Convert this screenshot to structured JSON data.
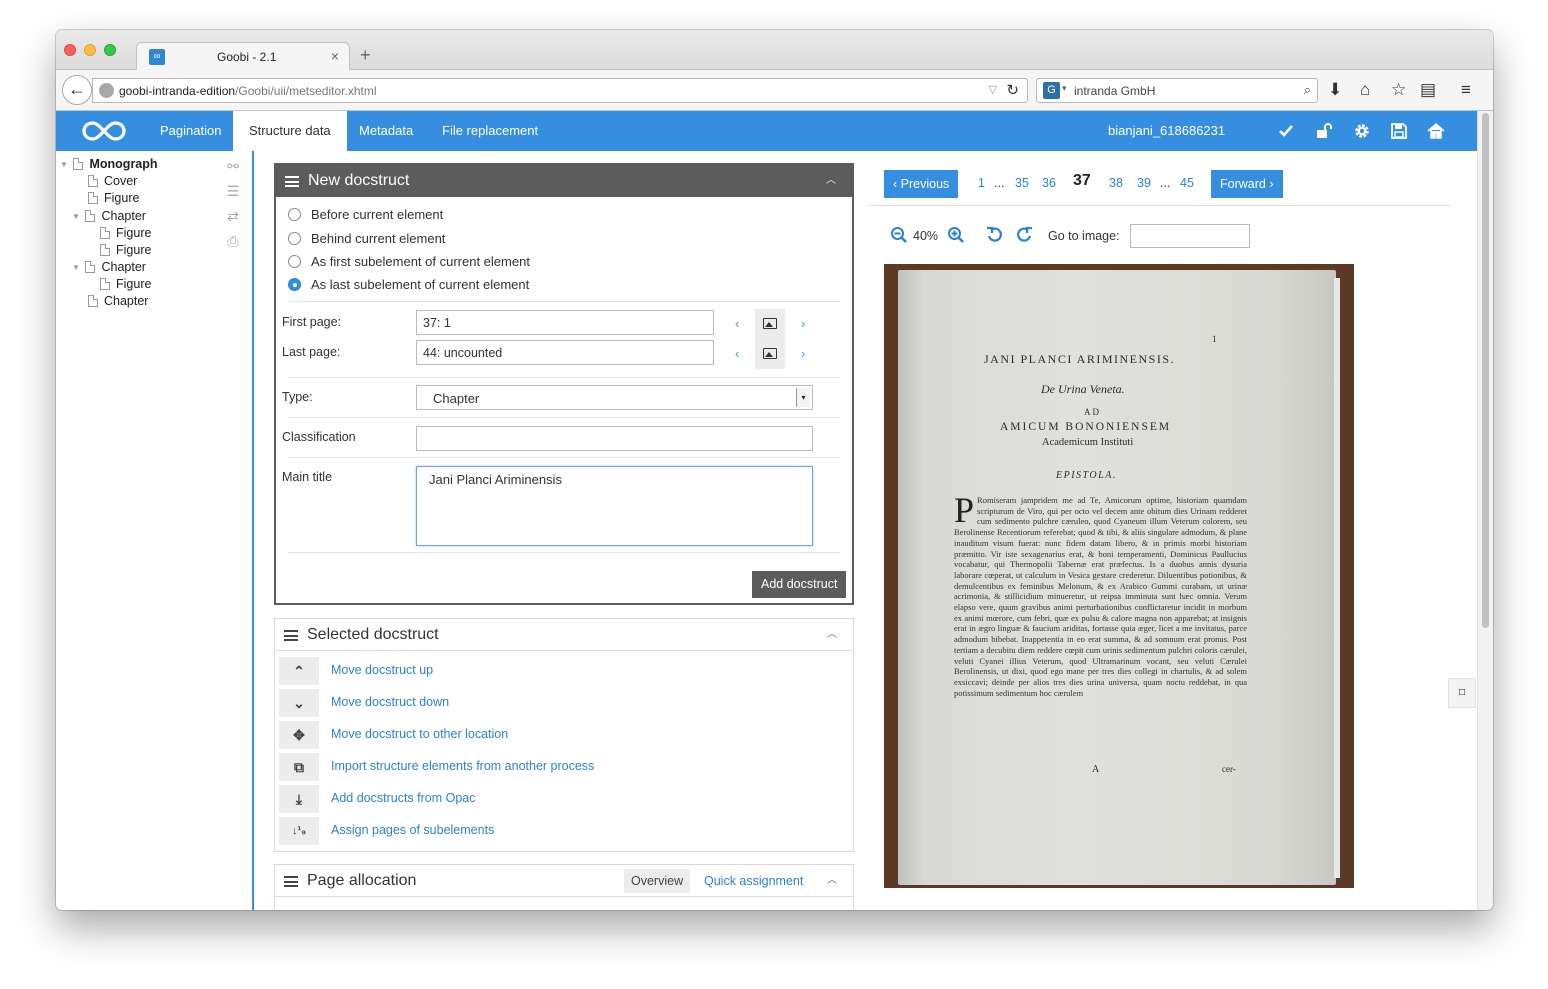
{
  "browser": {
    "tab_title": "Goobi - 2.1",
    "tab_favicon": "∞",
    "url_host": "goobi-intranda-edition",
    "url_path": "/Goobi/uii/metseditor.xhtml",
    "search_placeholder": "intranda GmbH",
    "search_engine_glyph": "G"
  },
  "header": {
    "nav": [
      "Pagination",
      "Structure data",
      "Metadata",
      "File replacement"
    ],
    "active_nav": "Structure data",
    "process_id": "bianjani_618686231",
    "accent_color": "#368ee0"
  },
  "tree": {
    "items": [
      {
        "label": "Monograph",
        "depth": 0,
        "expanded": true,
        "bold": true
      },
      {
        "label": "Cover",
        "depth": 1
      },
      {
        "label": "Figure",
        "depth": 1
      },
      {
        "label": "Chapter",
        "depth": 1,
        "expanded": true
      },
      {
        "label": "Figure",
        "depth": 2
      },
      {
        "label": "Figure",
        "depth": 2
      },
      {
        "label": "Chapter",
        "depth": 1,
        "expanded": true
      },
      {
        "label": "Figure",
        "depth": 2
      },
      {
        "label": "Chapter",
        "depth": 1
      }
    ]
  },
  "new_docstruct": {
    "title": "New docstruct",
    "options": [
      "Before current element",
      "Behind current element",
      "As first subelement of current element",
      "As last subelement of current element"
    ],
    "selected_option": "As last subelement of current element",
    "first_page_label": "First page:",
    "first_page_value": "37: 1",
    "last_page_label": "Last page:",
    "last_page_value": "44: uncounted",
    "type_label": "Type:",
    "type_value": "Chapter",
    "classification_label": "Classification",
    "classification_value": "",
    "main_title_label": "Main title",
    "main_title_value": "Jani Planci Ariminensis",
    "prev_glyph": "‹",
    "next_glyph": "›",
    "select_arrow": "▾",
    "add_button": "Add docstruct"
  },
  "selected_docstruct": {
    "title": "Selected docstruct",
    "actions": [
      {
        "icon": "chevron-up",
        "glyph": "⌃",
        "label": "Move docstruct up"
      },
      {
        "icon": "chevron-down",
        "glyph": "⌄",
        "label": "Move docstruct down"
      },
      {
        "icon": "move",
        "glyph": "✥",
        "label": "Move docstruct to other location"
      },
      {
        "icon": "puzzle",
        "glyph": "⧉",
        "label": "Import structure elements from another process"
      },
      {
        "icon": "download",
        "glyph": "⤓",
        "label": "Add docstructs from Opac"
      },
      {
        "icon": "sort-numeric",
        "glyph": "↓¹₉",
        "label": "Assign pages of subelements"
      }
    ]
  },
  "page_allocation": {
    "title": "Page allocation",
    "tab_overview": "Overview",
    "tab_quick": "Quick assignment"
  },
  "viewer": {
    "previous": "Previous",
    "forward": "Forward",
    "prev_glyph": "‹",
    "next_glyph": "›",
    "pages": [
      "1",
      "...",
      "35",
      "36",
      "37",
      "38",
      "39",
      "...",
      "45"
    ],
    "current_page": "37",
    "zoom": "40%",
    "goto_label": "Go to image:",
    "goto_value": ""
  },
  "scan": {
    "page_number": "1",
    "heading": "JANI PLANCI ARIMINENSIS.",
    "subtitle": "De Urina Veneta.",
    "ad": "AD",
    "amicum": "AMICUM BONONIENSEM",
    "academicum": "Academicum Instituti",
    "epistola": "EPISTOLA.",
    "dropcap": "P",
    "body": "Romiseram jampridem me ad Te, Amicorum optime, historiam quamdam scripturum de Viro, qui per octo vel decem ante obitum dies Urinam redderet cum sedimento pulchre cæruleo, quod Cyaneum illum Veterum colorem, seu Berolinense Recentiorum referebat; quod & tibi, & aliis singulare admodum, & plane inauditum visum fuerat: nunc fidem datam libero, & in primis morbi historiam præmitto. Vir iste sexagenarius erat, & boni temperamenti, Dominicus Paullucius vocabatur, qui Thermopolii Tabernæ erat præfectus. Is a duobus annis dysuria laborare cœperat, ut calculum in Vesica gestare crederetur. Diluentibus potionibus, & demulcentibus ex feminibus Melonum, & ex Arabico Gummi curabam, ut urinæ acrimonia, & stillicidium minueretur, ut reipsa imminuta sunt hæc omnia. Verum elapso vere, quum gravibus animi perturbationibus conflictaretur incidit in morbum ex animi mœrore, cum febri, quæ ex pulsu & calore magna non apparebat; at insignis erat in ægro linguæ & faucium ariditas, fortasse quia æger, licet a me invitatus, parce admodum bibebat. Inappetentia in eo erat summa, & ad somnum erat pronus. Post tertiam a decubitu diem reddere cœpit cum urinis sedimentum pulchri coloris cærulei, veluti Cyanei illius Veterum, quod Ultramarinum vocant, seu veluti Cærulei Berolinensis, ut dixi, quod ego mane per tres dies collegi in chartulis, & ad solem exsiccavi; deinde per alios tres dies urina universa, quam noctu reddebat, in qua potissimum sedimentum hoc cærulem",
    "signature": "A",
    "catchword": "cer-"
  }
}
